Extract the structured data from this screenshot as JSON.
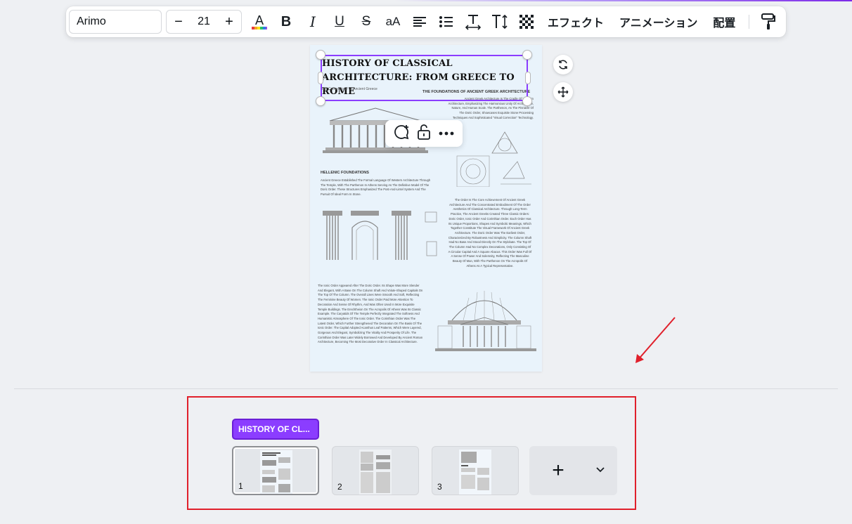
{
  "toolbar": {
    "font_name": "Arimo",
    "font_size": "21",
    "minus": "−",
    "plus": "+",
    "effects_label": "エフェクト",
    "animation_label": "アニメーション",
    "position_label": "配置"
  },
  "canvas": {
    "title": "HISTORY OF CLASSICAL ARCHITECTURE: FROM GREECE TO ROME",
    "subtitle": "The Cornerstone Of Ancient Greece",
    "section_1_heading": "THE FOUNDATIONS OF ANCIENT GREEK ARCHITECTURE",
    "section_1_text": "Ancient Greek Architecture Is The Cradle Of Western Architecture, Emphasizing The Harmonious Unity Of Architecture, Nature, And Human Scale. The Parthenon, As The Pinnacle Of The Doric Order, Showcases Exquisite Stone Processing Techniques And Sophisticated \"Visual Correction\" Technology.",
    "section_2_heading": "HELLENIC FOUNDATIONS",
    "section_2_text": "Ancient Greece Established The Formal Language Of Western Architecture Through The Temple, With The Parthenon In Athens Serving As The Definitive Model Of The Doric Order. These Structures Emphasized The Post-And-Lintel System And The Pursuit Of Ideal Form In Stone.",
    "section_3_text": "The Order Is The Core Achievement Of Ancient Greek Architecture And The Concentrated Embodiment Of The Order Aesthetics Of Classical Architecture. Through Long-Term Practice, The Ancient Greeks Created Three Classic Orders: Doric Order, Ionic Order And Corinthian Order. Each Order Has Its Unique Proportions, Shapes And Symbolic Meanings, Which Together Constitute The Visual Framework Of Ancient Greek Architecture. The Doric Order Was The Earliest Order, Characterized By Robustness And Simplicity. The Column Shaft Had No Base And Stood Directly On The Stylobate. The Top Of The Column Had No Complex Decorations, Only Consisting Of A Circular Capital And A Square Abacus. This Order Was Full Of A Sense Of Power And Solemnity, Reflecting The Masculine Beauty Of Man, With The Parthenon On The Acropolis Of Athens As A Typical Representative.",
    "section_4_text": "The Ionic Order Appeared After The Doric Order. Its Shape Was More Slender And Elegant, With A Base On The Column Shaft And Volute-Shaped Capitals On The Top Of The Column. The Overall Lines Were Smooth And Soft, Reflecting The Feminine Beauty Of Women. The Ionic Order Paid More Attention To Decoration And Sense Of Rhythm, And Was Often Used In More Exquisite Temple Buildings. The Erechtheion On The Acropolis Of Athens Was Its Classic Example. The Caryatids Of The Temple Perfectly Integrated The Softness And Humanistic Atmosphere Of The Ionic Order. The Corinthian Order Was The Latest Order, Which Further Strengthened The Decoration On The Basis Of The Ionic Order. The Capital Adopted Acanthus Leaf Patterns, Which Were Layered, Gorgeous And Elegant, Symbolizing The Vitality And Prosperity Of Life. The Corinthian Order Was Later Widely Borrowed And Developed By Ancient Roman Architecture, Becoming The Most Decorative Order In Classical Architecture."
  },
  "pages_panel": {
    "selected_page_label": "HISTORY OF CL...",
    "pages": [
      {
        "number": "1"
      },
      {
        "number": "2"
      },
      {
        "number": "3"
      }
    ],
    "add_label": "+"
  },
  "colors": {
    "accent": "#8b3dff",
    "highlight_rect": "#e0202b",
    "arrow": "#e0202b"
  }
}
